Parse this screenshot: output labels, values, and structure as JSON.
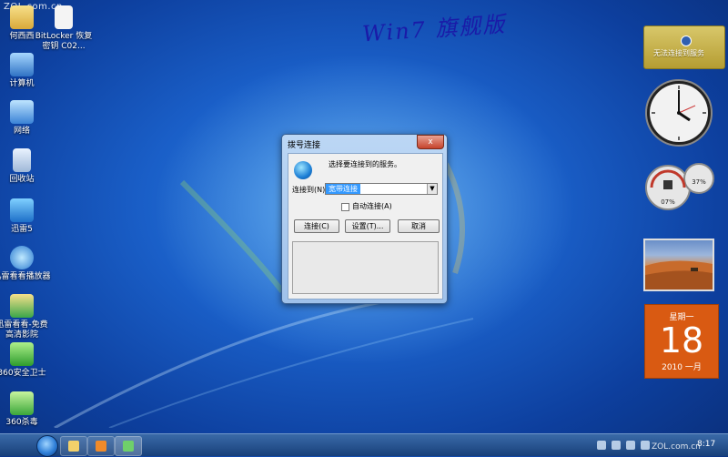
{
  "watermark": {
    "top_left": "ZOL.com.cn",
    "bottom_right": "ZOL.com.cn"
  },
  "handwriting": "Win7 旗舰版",
  "desktop_icons": [
    {
      "label": "何西西"
    },
    {
      "label": "BitLocker 恢复密钥 C02..."
    },
    {
      "label": "计算机"
    },
    {
      "label": "网络"
    },
    {
      "label": "回收站"
    },
    {
      "label": "迅雷5"
    },
    {
      "label": "迅雷看看播放器"
    },
    {
      "label": "迅雷看看-免费高清影院"
    },
    {
      "label": "360安全卫士"
    },
    {
      "label": "360杀毒"
    }
  ],
  "gadgets": {
    "service": {
      "text": "无法连接到服务"
    },
    "meter": {
      "cpu": "07%",
      "memory": "37%"
    },
    "calendar": {
      "weekday": "星期一",
      "day": "18",
      "year_month": "2010 一月"
    }
  },
  "dialog": {
    "title": "拨号连接",
    "close": "x",
    "prompt": "选择要连接到的服务。",
    "connect_to_label": "连接到(N):",
    "connect_to_value": "宽带连接",
    "autoconnect_label": "自动连接(A)",
    "buttons": {
      "connect": "连接(C)",
      "settings": "设置(T)...",
      "cancel": "取消"
    }
  },
  "taskbar": {
    "time": "8:17"
  },
  "colors": {
    "desktop": "#1a5fc8",
    "calendar": "#d95a12",
    "selection": "#3399ff"
  }
}
